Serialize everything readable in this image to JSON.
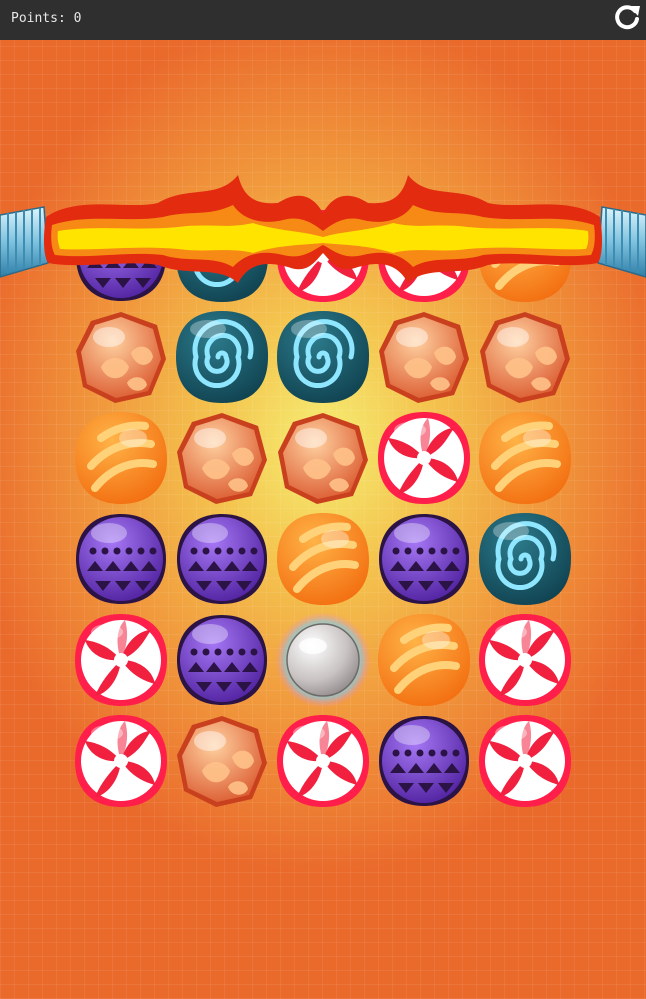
{
  "header": {
    "points_label": "Points: 0",
    "restart_icon": "refresh-icon"
  },
  "board": {
    "rows": [
      [
        "purple-tribal",
        "teal-swirl",
        "red-peppermint",
        "red-peppermint",
        "orange-striped"
      ],
      [
        "peach-hexagon",
        "teal-swirl",
        "teal-swirl",
        "peach-hexagon",
        "peach-hexagon"
      ],
      [
        "orange-striped",
        "peach-hexagon",
        "peach-hexagon",
        "red-peppermint",
        "orange-striped"
      ],
      [
        "purple-tribal",
        "purple-tribal",
        "orange-striped",
        "purple-tribal",
        "teal-swirl"
      ],
      [
        "red-peppermint",
        "purple-tribal",
        "pearl-bomb",
        "orange-striped",
        "red-peppermint"
      ],
      [
        "red-peppermint",
        "peach-hexagon",
        "red-peppermint",
        "purple-tribal",
        "red-peppermint"
      ]
    ],
    "effect": "fire-beam",
    "colors": {
      "topbar": "#2f2f2f",
      "background_center": "#f6ee73",
      "background_edge": "#ea6a2c"
    }
  }
}
